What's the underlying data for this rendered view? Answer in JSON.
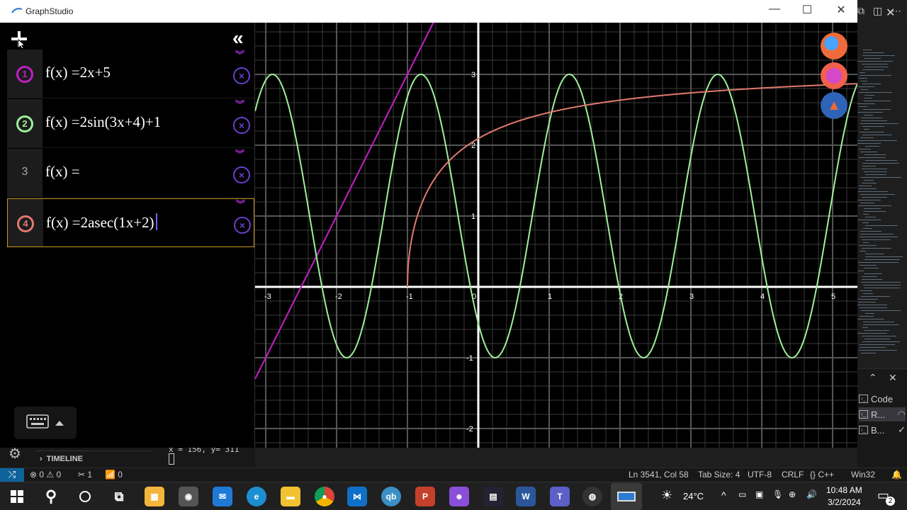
{
  "window": {
    "title": "GraphStudio",
    "minimize": "—",
    "maximize": "☐",
    "close": "✕"
  },
  "sidebar": {
    "add_icon": "plus-icon",
    "collapse_label": "«",
    "functions": [
      {
        "index": "1",
        "prefix": "f(x) =",
        "expr": "2x+5",
        "color": "#c21fc2",
        "badge": true,
        "active": false
      },
      {
        "index": "2",
        "prefix": "f(x) =",
        "expr": "2sin(3x+4)+1",
        "color": "#9ef09a",
        "badge": true,
        "active": false
      },
      {
        "index": "3",
        "prefix": "f(x) =",
        "expr": "",
        "color": "#aaaaaa",
        "badge": false,
        "active": false
      },
      {
        "index": "4",
        "prefix": "f(x) =",
        "expr": "2asec(1x+2)",
        "color": "#e07a6e",
        "badge": true,
        "active": true
      }
    ],
    "delete_label": "×",
    "expand_label": "︾",
    "keyboard_icon": "keyboard-icon"
  },
  "graph": {
    "x_ticks": [
      "-3",
      "-2",
      "-1",
      "0",
      "1",
      "2",
      "3",
      "4",
      "5"
    ],
    "y_ticks_pos": [
      "1",
      "2",
      "3"
    ],
    "y_ticks_neg": [
      "-1",
      "-2"
    ],
    "xlim": [
      -3.15,
      5.35
    ],
    "ylim": [
      -2.27,
      3.73
    ],
    "axis_color": "#ffffff",
    "grid_color": "#3a3a3a",
    "major_grid_color": "#555555"
  },
  "chart_data": {
    "type": "line",
    "title": "",
    "xlabel": "",
    "ylabel": "",
    "xlim": [
      -3.15,
      5.35
    ],
    "ylim": [
      -2.27,
      3.73
    ],
    "grid": true,
    "series": [
      {
        "name": "2x+5",
        "formula": "2x+5",
        "color": "#c21fc2"
      },
      {
        "name": "2sin(3x+4)+1",
        "formula": "2sin(3x+4)+1",
        "color": "#9ef09a"
      },
      {
        "name": "2asec(1x+2)",
        "formula": "2asec(1x+2)",
        "color": "#e07a6e"
      }
    ]
  },
  "vscode": {
    "panel_items": [
      {
        "label": "Code"
      },
      {
        "label": "R..."
      },
      {
        "label": "B..."
      }
    ],
    "timeline": "TIMELINE",
    "coord_text": "x = 156, y= 311",
    "status": {
      "errors": "0",
      "warnings": "0",
      "tools": "1",
      "ports": "0",
      "position": "Ln 3541, Col 58",
      "tab_size": "Tab Size: 4",
      "encoding": "UTF-8",
      "eol": "CRLF",
      "language": "{} C++",
      "platform": "Win32"
    }
  },
  "taskbar": {
    "weather": "24°C",
    "time": "10:48 AM",
    "date": "3/2/2024",
    "notifications": "2"
  }
}
